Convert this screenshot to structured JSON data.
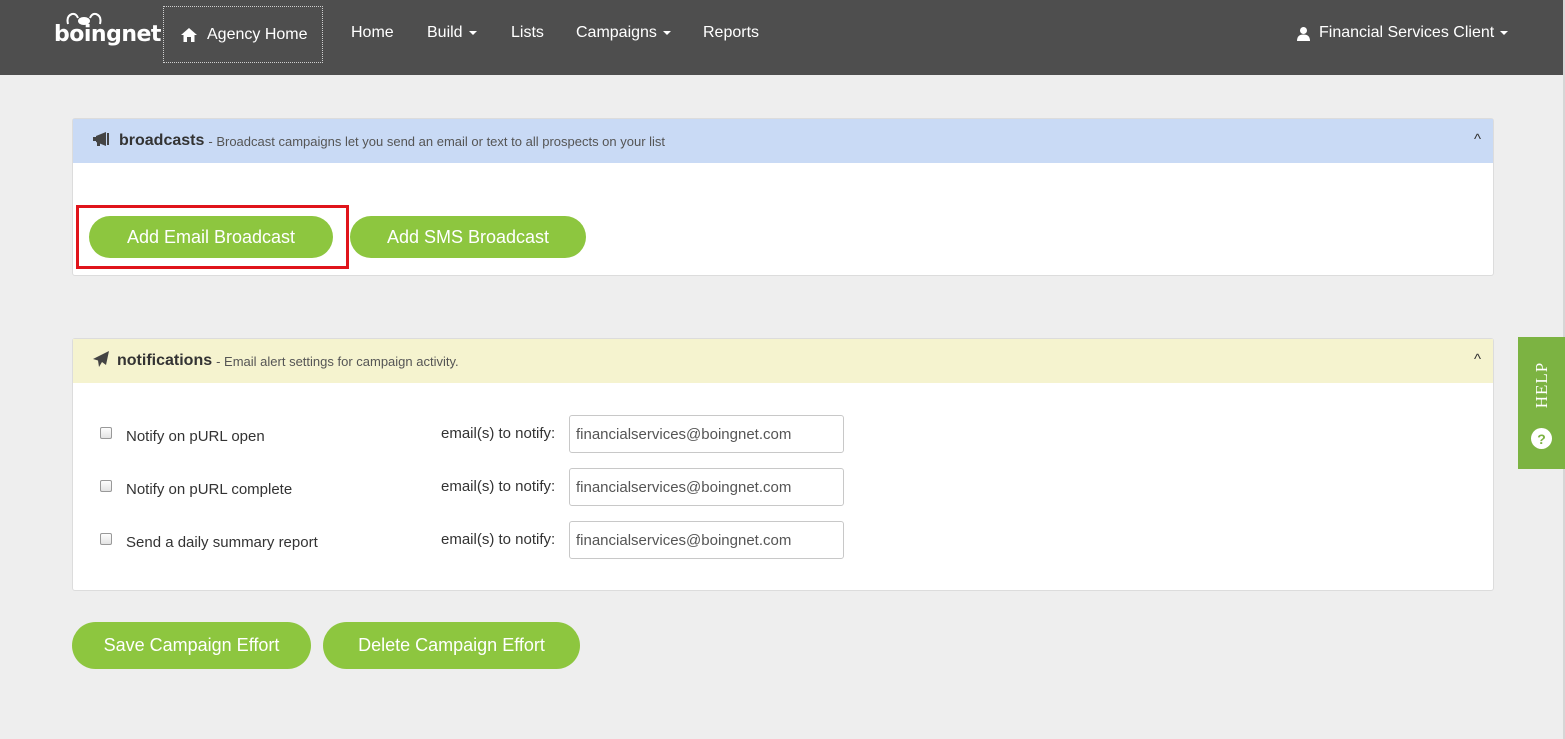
{
  "nav": {
    "logo_text": "boingnet",
    "agency_home": "Agency Home",
    "items": {
      "home": "Home",
      "build": "Build",
      "lists": "Lists",
      "campaigns": "Campaigns",
      "reports": "Reports"
    },
    "user": "Financial Services Client"
  },
  "broadcasts": {
    "title": "broadcasts",
    "description": "- Broadcast campaigns let you send an email or text to all prospects on your list",
    "collapse": "^",
    "add_email_label": "Add Email Broadcast",
    "add_sms_label": "Add SMS Broadcast"
  },
  "notifications": {
    "title": "notifications",
    "description": "- Email alert settings for campaign activity.",
    "collapse": "^",
    "rows": [
      {
        "label": "Notify on pURL open",
        "email_label": "email(s) to notify:",
        "email": "financialservices@boingnet.com",
        "checked": false
      },
      {
        "label": "Notify on pURL complete",
        "email_label": "email(s) to notify:",
        "email": "financialservices@boingnet.com",
        "checked": false
      },
      {
        "label": "Send a daily summary report",
        "email_label": "email(s) to notify:",
        "email": "financialservices@boingnet.com",
        "checked": false
      }
    ]
  },
  "actions": {
    "save_label": "Save Campaign Effort",
    "delete_label": "Delete Campaign Effort"
  },
  "help": {
    "label": "HELP",
    "icon_text": "?"
  },
  "colors": {
    "topbar": "#4e4e4e",
    "accent_green": "#8dc63f",
    "broadcast_header": "#c9daf5",
    "notification_header": "#f5f3cf",
    "highlight": "#e0141b"
  }
}
